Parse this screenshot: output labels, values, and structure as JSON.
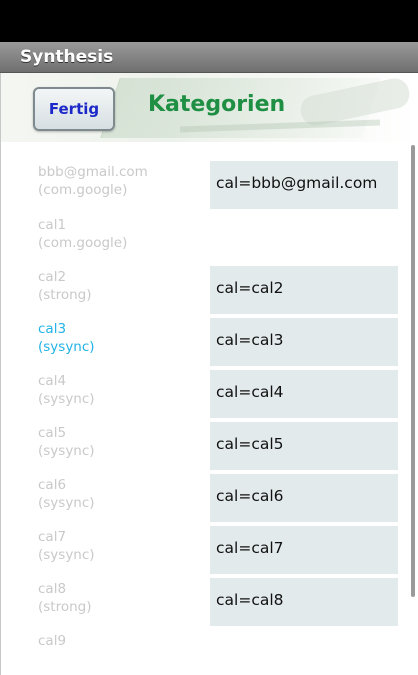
{
  "app": {
    "title": "Synthesis"
  },
  "header": {
    "done_label": "Fertig",
    "title": "Kategorien"
  },
  "rows": [
    {
      "name": "bbb@gmail.com",
      "type": "(com.google)",
      "value": "cal=bbb@gmail.com",
      "selected": false
    },
    {
      "name": "cal1",
      "type": "(com.google)",
      "value": "",
      "selected": false
    },
    {
      "name": "cal2",
      "type": "(strong)",
      "value": "cal=cal2",
      "selected": false
    },
    {
      "name": "cal3",
      "type": "(sysync)",
      "value": "cal=cal3",
      "selected": true
    },
    {
      "name": "cal4",
      "type": "(sysync)",
      "value": "cal=cal4",
      "selected": false
    },
    {
      "name": "cal5",
      "type": "(sysync)",
      "value": "cal=cal5",
      "selected": false
    },
    {
      "name": "cal6",
      "type": "(sysync)",
      "value": "cal=cal6",
      "selected": false
    },
    {
      "name": "cal7",
      "type": "(sysync)",
      "value": "cal=cal7",
      "selected": false
    },
    {
      "name": "cal8",
      "type": "(strong)",
      "value": "cal=cal8",
      "selected": false
    },
    {
      "name": "cal9",
      "type": "",
      "value": "",
      "selected": false
    }
  ]
}
